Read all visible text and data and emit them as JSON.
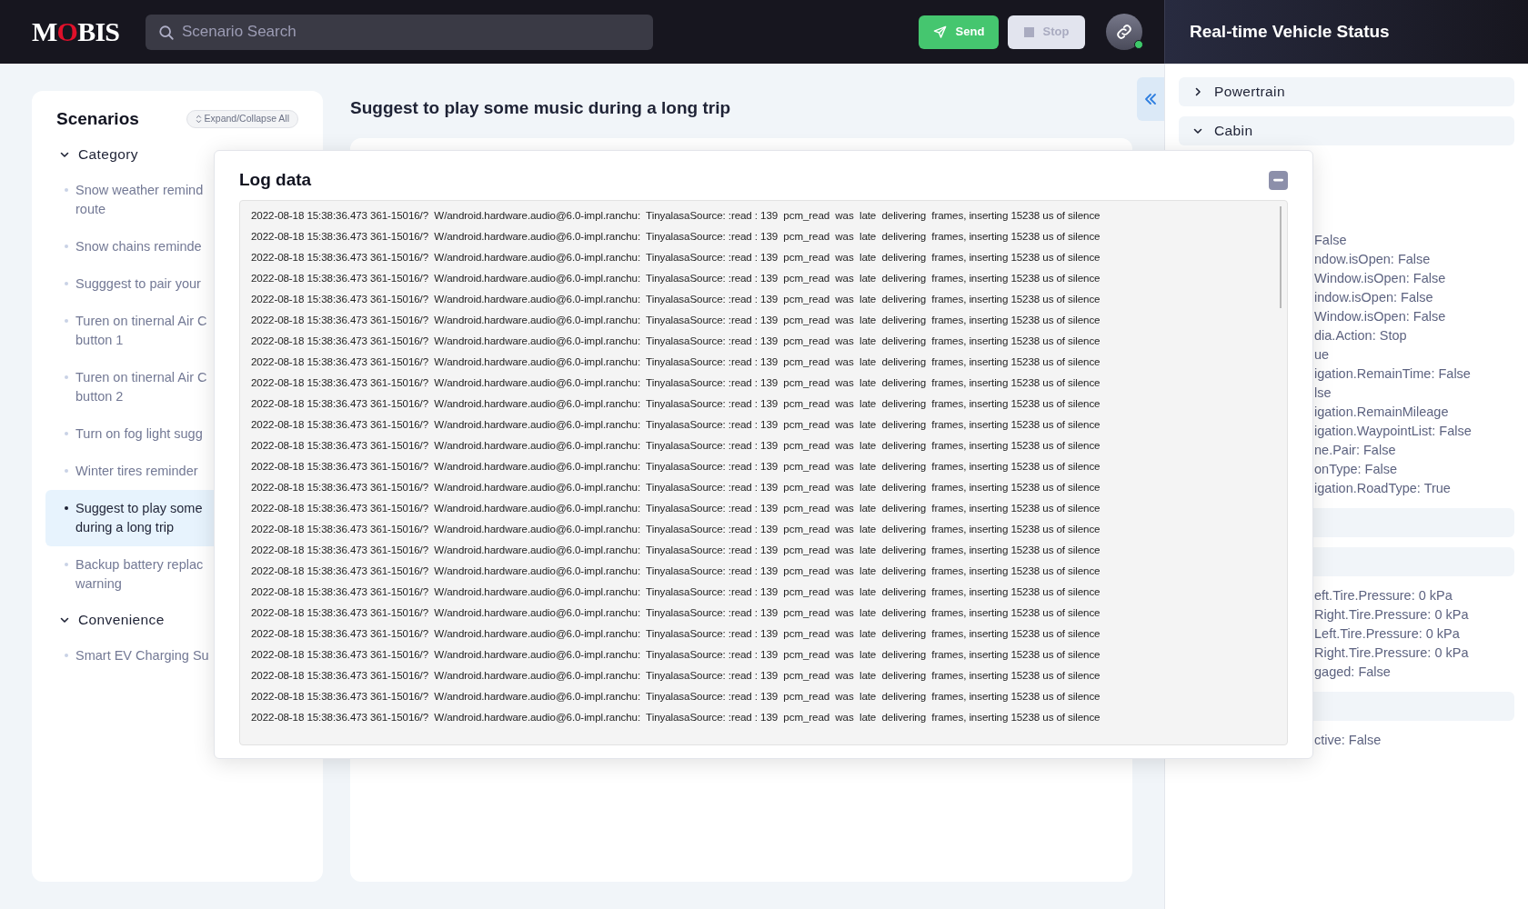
{
  "header": {
    "logo": {
      "parts": [
        {
          "text": "M",
          "accent": false
        },
        {
          "text": "O",
          "accent": true
        },
        {
          "text": "BIS",
          "accent": false
        }
      ]
    },
    "search": {
      "placeholder": "Scenario Search"
    },
    "buttons": [
      {
        "label": "Send",
        "kind": "send",
        "disabled": false
      },
      {
        "label": "Stop",
        "kind": "stop",
        "disabled": true
      }
    ],
    "connection": {
      "connected": true
    }
  },
  "sidebar": {
    "title": "Scenarios",
    "toggle": "Expand/Collapse All",
    "groups": [
      {
        "label": "Category",
        "expanded": true,
        "items": [
          {
            "label": "Snow weather remind\nroute",
            "selected": false
          },
          {
            "label": "Snow chains reminde",
            "selected": false
          },
          {
            "label": "Sugggest to pair your",
            "selected": false
          },
          {
            "label": "Turen on tinernal Air C\nbutton 1",
            "selected": false
          },
          {
            "label": "Turen on tinernal Air C\nbutton 2",
            "selected": false
          },
          {
            "label": "Turn on fog light sugg",
            "selected": false
          },
          {
            "label": "Winter tires reminder",
            "selected": false
          },
          {
            "label": "Suggest to play some\nduring a long trip",
            "selected": true
          },
          {
            "label": "Backup battery replac\nwarning",
            "selected": false
          }
        ]
      },
      {
        "label": "Convenience",
        "expanded": true,
        "items": [
          {
            "label": "Smart EV Charging Su",
            "selected": false
          }
        ]
      }
    ]
  },
  "main": {
    "title": "Suggest to play some music during a long trip"
  },
  "log_panel": {
    "title": "Log data",
    "lines": [
      "2022-08-18 15:38:36.473 361-15016/?  W/android.hardware.audio@6.0-impl.ranchu:  TinyalasaSource: :read : 139  pcm_read  was  late  delivering  frames, inserting 15238 us of silence",
      "2022-08-18 15:38:36.473 361-15016/?  W/android.hardware.audio@6.0-impl.ranchu:  TinyalasaSource: :read : 139  pcm_read  was  late  delivering  frames, inserting 15238 us of silence",
      "2022-08-18 15:38:36.473 361-15016/?  W/android.hardware.audio@6.0-impl.ranchu:  TinyalasaSource: :read : 139  pcm_read  was  late  delivering  frames, inserting 15238 us of silence",
      "2022-08-18 15:38:36.473 361-15016/?  W/android.hardware.audio@6.0-impl.ranchu:  TinyalasaSource: :read : 139  pcm_read  was  late  delivering  frames, inserting 15238 us of silence",
      "2022-08-18 15:38:36.473 361-15016/?  W/android.hardware.audio@6.0-impl.ranchu:  TinyalasaSource: :read : 139  pcm_read  was  late  delivering  frames, inserting 15238 us of silence",
      "2022-08-18 15:38:36.473 361-15016/?  W/android.hardware.audio@6.0-impl.ranchu:  TinyalasaSource: :read : 139  pcm_read  was  late  delivering  frames, inserting 15238 us of silence",
      "2022-08-18 15:38:36.473 361-15016/?  W/android.hardware.audio@6.0-impl.ranchu:  TinyalasaSource: :read : 139  pcm_read  was  late  delivering  frames, inserting 15238 us of silence",
      "2022-08-18 15:38:36.473 361-15016/?  W/android.hardware.audio@6.0-impl.ranchu:  TinyalasaSource: :read : 139  pcm_read  was  late  delivering  frames, inserting 15238 us of silence",
      "2022-08-18 15:38:36.473 361-15016/?  W/android.hardware.audio@6.0-impl.ranchu:  TinyalasaSource: :read : 139  pcm_read  was  late  delivering  frames, inserting 15238 us of silence",
      "2022-08-18 15:38:36.473 361-15016/?  W/android.hardware.audio@6.0-impl.ranchu:  TinyalasaSource: :read : 139  pcm_read  was  late  delivering  frames, inserting 15238 us of silence",
      "2022-08-18 15:38:36.473 361-15016/?  W/android.hardware.audio@6.0-impl.ranchu:  TinyalasaSource: :read : 139  pcm_read  was  late  delivering  frames, inserting 15238 us of silence",
      "2022-08-18 15:38:36.473 361-15016/?  W/android.hardware.audio@6.0-impl.ranchu:  TinyalasaSource: :read : 139  pcm_read  was  late  delivering  frames, inserting 15238 us of silence",
      "2022-08-18 15:38:36.473 361-15016/?  W/android.hardware.audio@6.0-impl.ranchu:  TinyalasaSource: :read : 139  pcm_read  was  late  delivering  frames, inserting 15238 us of silence",
      "2022-08-18 15:38:36.473 361-15016/?  W/android.hardware.audio@6.0-impl.ranchu:  TinyalasaSource: :read : 139  pcm_read  was  late  delivering  frames, inserting 15238 us of silence",
      "2022-08-18 15:38:36.473 361-15016/?  W/android.hardware.audio@6.0-impl.ranchu:  TinyalasaSource: :read : 139  pcm_read  was  late  delivering  frames, inserting 15238 us of silence",
      "2022-08-18 15:38:36.473 361-15016/?  W/android.hardware.audio@6.0-impl.ranchu:  TinyalasaSource: :read : 139  pcm_read  was  late  delivering  frames, inserting 15238 us of silence",
      "2022-08-18 15:38:36.473 361-15016/?  W/android.hardware.audio@6.0-impl.ranchu:  TinyalasaSource: :read : 139  pcm_read  was  late  delivering  frames, inserting 15238 us of silence",
      "2022-08-18 15:38:36.473 361-15016/?  W/android.hardware.audio@6.0-impl.ranchu:  TinyalasaSource: :read : 139  pcm_read  was  late  delivering  frames, inserting 15238 us of silence",
      "2022-08-18 15:38:36.473 361-15016/?  W/android.hardware.audio@6.0-impl.ranchu:  TinyalasaSource: :read : 139  pcm_read  was  late  delivering  frames, inserting 15238 us of silence",
      "2022-08-18 15:38:36.473 361-15016/?  W/android.hardware.audio@6.0-impl.ranchu:  TinyalasaSource: :read : 139  pcm_read  was  late  delivering  frames, inserting 15238 us of silence",
      "2022-08-18 15:38:36.473 361-15016/?  W/android.hardware.audio@6.0-impl.ranchu:  TinyalasaSource: :read : 139  pcm_read  was  late  delivering  frames, inserting 15238 us of silence",
      "2022-08-18 15:38:36.473 361-15016/?  W/android.hardware.audio@6.0-impl.ranchu:  TinyalasaSource: :read : 139  pcm_read  was  late  delivering  frames, inserting 15238 us of silence",
      "2022-08-18 15:38:36.473 361-15016/?  W/android.hardware.audio@6.0-impl.ranchu:  TinyalasaSource: :read : 139  pcm_read  was  late  delivering  frames, inserting 15238 us of silence",
      "2022-08-18 15:38:36.473 361-15016/?  W/android.hardware.audio@6.0-impl.ranchu:  TinyalasaSource: :read : 139  pcm_read  was  late  delivering  frames, inserting 15238 us of silence",
      "2022-08-18 15:38:36.473 361-15016/?  W/android.hardware.audio@6.0-impl.ranchu:  TinyalasaSource: :read : 139  pcm_read  was  late  delivering  frames, inserting 15238 us of silence"
    ]
  },
  "status_panel": {
    "title": "Real-time Vehicle Status",
    "sections": [
      {
        "label": "Powertrain",
        "expanded": false
      },
      {
        "label": "Cabin",
        "expanded": true,
        "values": [
          "False",
          "ndow.isOpen: False",
          "Window.isOpen: False",
          "indow.isOpen: False",
          "Window.isOpen: False",
          "dia.Action: Stop",
          "ue",
          "igation.RemainTime: False",
          "lse",
          "igation.RemainMileage",
          "igation.WaypointList: False",
          "ne.Pair: False",
          "onType: False",
          "igation.RoadType: True"
        ]
      },
      {
        "kind": "group"
      },
      {
        "kind": "group",
        "values": [
          "eft.Tire.Pressure: 0 kPa",
          "Right.Tire.Pressure: 0 kPa",
          "Left.Tire.Pressure: 0 kPa",
          "Right.Tire.Pressure: 0 kPa",
          "gaged: False"
        ]
      },
      {
        "kind": "group",
        "values": [
          "ctive: False"
        ]
      }
    ]
  }
}
